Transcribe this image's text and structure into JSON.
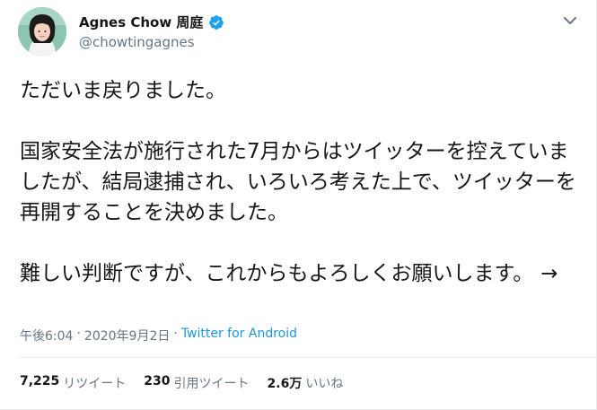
{
  "author": {
    "display_name": "Agnes Chow 周庭",
    "handle": "@chowtingagnes",
    "verified": true
  },
  "tweet": {
    "paragraphs": [
      "ただいま戻りました。",
      "国家安全法が施行された7月からはツイッターを控えていましたが、結局逮捕され、いろいろ考えた上で、ツイッターを再開することを決めました。",
      "難しい判断ですが、これからもよろしくお願いします。"
    ],
    "arrow": "→"
  },
  "meta": {
    "time": "午後6:04",
    "separator": "·",
    "date": "2020年9月2日",
    "source": "Twitter for Android"
  },
  "stats": {
    "retweets_count": "7,225",
    "retweets_label": "リツイート",
    "quotes_count": "230",
    "quotes_label": "引用ツイート",
    "likes_count": "2.6万",
    "likes_label": "いいね"
  },
  "colors": {
    "link": "#1b95e0",
    "verified": "#1da1f2",
    "secondary_text": "#657786"
  }
}
